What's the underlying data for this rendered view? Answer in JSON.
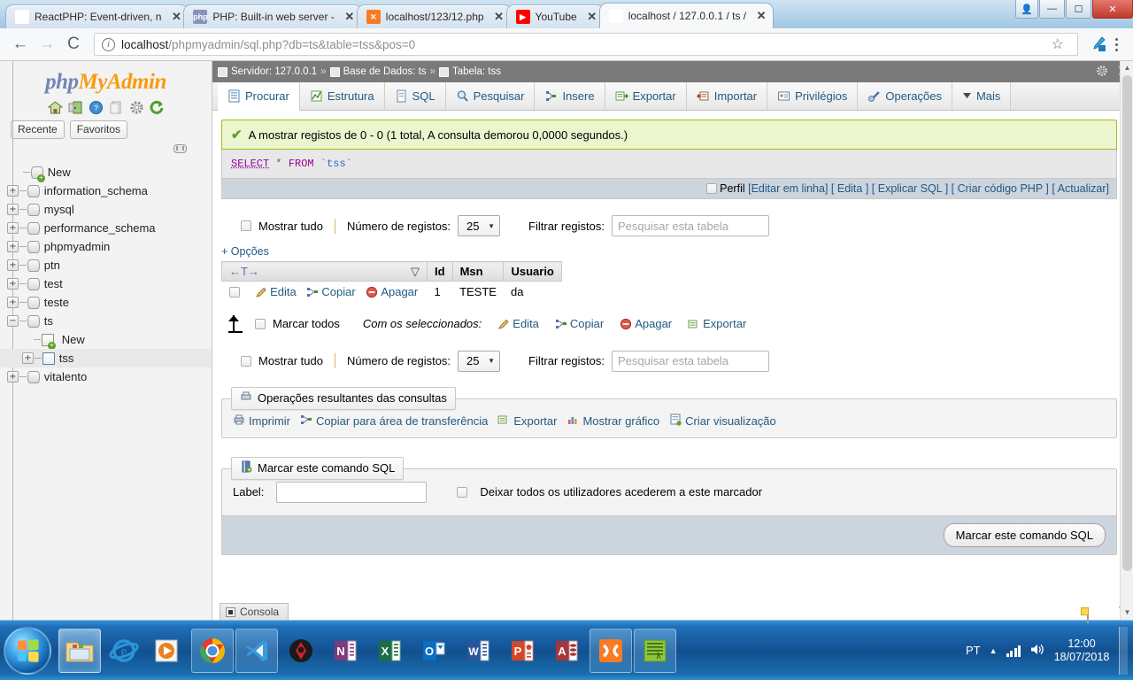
{
  "browser": {
    "tabs": [
      {
        "title": "ReactPHP: Event-driven, n",
        "favicon": "react-icon",
        "active": false
      },
      {
        "title": "PHP: Built-in web server -",
        "favicon": "php-icon",
        "active": false
      },
      {
        "title": "localhost/123/12.php",
        "favicon": "xampp-icon",
        "active": false
      },
      {
        "title": "YouTube",
        "favicon": "youtube-icon",
        "active": false
      },
      {
        "title": "localhost / 127.0.0.1 / ts /",
        "favicon": "phpmyadmin-icon",
        "active": true
      }
    ],
    "close_label": "✕",
    "window_buttons": {
      "user": "",
      "minimize": "",
      "maximize": "",
      "close": ""
    },
    "nav": {
      "back": "←",
      "forward": "→",
      "reload": "C"
    },
    "url_strong": "localhost",
    "url_dim": "/phpmyadmin/sql.php?db=ts&table=tss&pos=0",
    "star": "☆"
  },
  "sidebar": {
    "logo_part1": "php",
    "logo_part2": "MyAdmin",
    "icons": [
      "home-icon",
      "logout-icon",
      "help-icon",
      "docs-icon",
      "settings-icon",
      "reload-icon"
    ],
    "chips": [
      {
        "label": "Recente"
      },
      {
        "label": "Favoritos"
      }
    ],
    "tree": [
      {
        "label": "New",
        "level": 1,
        "expander": "",
        "icon": "new-db-icon",
        "selected": false
      },
      {
        "label": "information_schema",
        "level": 1,
        "expander": "+",
        "icon": "db-icon",
        "selected": false
      },
      {
        "label": "mysql",
        "level": 1,
        "expander": "+",
        "icon": "db-icon",
        "selected": false
      },
      {
        "label": "performance_schema",
        "level": 1,
        "expander": "+",
        "icon": "db-icon",
        "selected": false
      },
      {
        "label": "phpmyadmin",
        "level": 1,
        "expander": "+",
        "icon": "db-icon",
        "selected": false
      },
      {
        "label": "ptn",
        "level": 1,
        "expander": "+",
        "icon": "db-icon",
        "selected": false
      },
      {
        "label": "test",
        "level": 1,
        "expander": "+",
        "icon": "db-icon",
        "selected": false
      },
      {
        "label": "teste",
        "level": 1,
        "expander": "+",
        "icon": "db-icon",
        "selected": false
      },
      {
        "label": "ts",
        "level": 1,
        "expander": "−",
        "icon": "db-icon",
        "selected": false
      },
      {
        "label": "New",
        "level": 2,
        "expander": "",
        "icon": "new-table-icon",
        "selected": false
      },
      {
        "label": "tss",
        "level": 2,
        "expander": "+",
        "icon": "table-icon",
        "selected": true
      },
      {
        "label": "vitalento",
        "level": 1,
        "expander": "+",
        "icon": "db-icon",
        "selected": false
      }
    ]
  },
  "breadcrumb": {
    "server_label": "Servidor: 127.0.0.1",
    "db_label": "Base de Dados: ts",
    "table_label": "Tabela: tss",
    "separator": "»"
  },
  "tabs": [
    {
      "label": "Procurar",
      "icon": "browse-icon",
      "active": true
    },
    {
      "label": "Estrutura",
      "icon": "structure-icon",
      "active": false
    },
    {
      "label": "SQL",
      "icon": "sql-icon",
      "active": false
    },
    {
      "label": "Pesquisar",
      "icon": "search-icon",
      "active": false
    },
    {
      "label": "Insere",
      "icon": "insert-icon",
      "active": false
    },
    {
      "label": "Exportar",
      "icon": "export-icon",
      "active": false
    },
    {
      "label": "Importar",
      "icon": "import-icon",
      "active": false
    },
    {
      "label": "Privilégios",
      "icon": "privileges-icon",
      "active": false
    },
    {
      "label": "Operações",
      "icon": "operations-icon",
      "active": false
    },
    {
      "label": "Mais",
      "icon": "chevron-down-icon",
      "active": false
    }
  ],
  "result": {
    "success_message": "A mostrar registos de 0 - 0 (1 total, A consulta demorou 0,0000 segundos.)",
    "sql": {
      "keyword1": "SELECT",
      "star": "*",
      "keyword2": "FROM",
      "table": "`tss`"
    },
    "footer_links": {
      "profile": "Perfil",
      "inline_edit": "[Editar em linha]",
      "edit": "[ Edita ]",
      "explain": "[ Explicar SQL ]",
      "create_php": "[ Criar código PHP ]",
      "refresh": "[ Actualizar]"
    }
  },
  "controls": {
    "show_all_label": "Mostrar tudo",
    "rows_label": "Número de registos:",
    "rows_value": "25",
    "filter_label": "Filtrar registos:",
    "filter_placeholder": "Pesquisar esta tabela",
    "options_label": "+ Opções"
  },
  "table": {
    "nav_header": "←T→",
    "sort_icon": "sort-desc-icon",
    "columns": [
      "Id",
      "Msn",
      "Usuario"
    ],
    "row_actions": [
      {
        "label": "Edita",
        "icon": "pencil-icon"
      },
      {
        "label": "Copiar",
        "icon": "copy-icon"
      },
      {
        "label": "Apagar",
        "icon": "delete-icon"
      }
    ],
    "rows": [
      {
        "id": "1",
        "msn": "TESTE",
        "usuario": "da"
      }
    ],
    "check_all_label": "Marcar todos",
    "with_selected_label": "Com os seleccionados:",
    "bulk_actions": [
      {
        "label": "Edita",
        "icon": "pencil-icon"
      },
      {
        "label": "Copiar",
        "icon": "copy-icon"
      },
      {
        "label": "Apagar",
        "icon": "delete-icon"
      },
      {
        "label": "Exportar",
        "icon": "export-icon"
      }
    ]
  },
  "query_ops": {
    "legend": "Operações resultantes das consultas",
    "legend_icon": "print-preview-icon",
    "links": [
      {
        "label": "Imprimir",
        "icon": "print-icon"
      },
      {
        "label": "Copiar para área de transferência",
        "icon": "clipboard-icon"
      },
      {
        "label": "Exportar",
        "icon": "export-icon"
      },
      {
        "label": "Mostrar gráfico",
        "icon": "chart-icon"
      },
      {
        "label": "Criar visualização",
        "icon": "view-icon"
      }
    ]
  },
  "bookmark": {
    "legend": "Marcar este comando SQL",
    "legend_icon": "bookmark-icon",
    "label_text": "Label:",
    "label_value": "",
    "checkbox_label": "Deixar todos os utilizadores acederem a este marcador",
    "submit_label": "Marcar este comando SQL"
  },
  "console": {
    "label": "Consola",
    "icon": "console-icon"
  },
  "taskbar": {
    "start_label": "start-orb",
    "items": [
      {
        "name": "explorer-icon",
        "state": "pinned"
      },
      {
        "name": "internet-explorer-icon",
        "state": "pinned"
      },
      {
        "name": "media-player-icon",
        "state": "pinned"
      },
      {
        "name": "chrome-icon",
        "state": "running-active"
      },
      {
        "name": "vscode-icon",
        "state": "running"
      },
      {
        "name": "hitman-icon",
        "state": "pinned"
      },
      {
        "name": "onenote-icon",
        "state": "pinned"
      },
      {
        "name": "excel-icon",
        "state": "pinned"
      },
      {
        "name": "outlook-icon",
        "state": "pinned"
      },
      {
        "name": "word-icon",
        "state": "pinned"
      },
      {
        "name": "powerpoint-icon",
        "state": "pinned"
      },
      {
        "name": "access-icon",
        "state": "pinned"
      },
      {
        "name": "xampp-icon",
        "state": "running"
      },
      {
        "name": "notepad-app-icon",
        "state": "running"
      }
    ],
    "tray": {
      "language": "PT",
      "expand": "▲",
      "network_icon": "signal-icon",
      "volume_icon": "volume-icon",
      "time": "12:00",
      "date": "18/07/2018"
    }
  },
  "colors": {
    "accent_blue": "#235a81",
    "success_bg": "#ebf5ce",
    "success_border": "#a2c11a",
    "pma_orange": "#f89c0e",
    "pma_purple": "#7286b5",
    "taskbar_blue": "#12508f"
  }
}
